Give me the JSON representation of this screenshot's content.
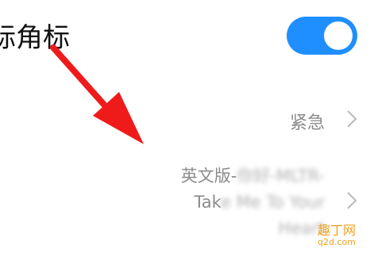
{
  "setting": {
    "label": "标角标",
    "toggle_on": true,
    "toggle_color": "#1f8fff"
  },
  "priority": {
    "value": "紧急"
  },
  "ringtone": {
    "line1_visible": "英文版-",
    "line1_blurred": "你好-MLTR-",
    "line2_visible": "Tak",
    "line2_blurred": "e Me To Your",
    "line3_blurred": "Heart"
  },
  "annotation": {
    "arrow_color": "#ef1b1b"
  },
  "watermark": {
    "text_cn": "趣丁网",
    "text_en": "q2d.com"
  }
}
